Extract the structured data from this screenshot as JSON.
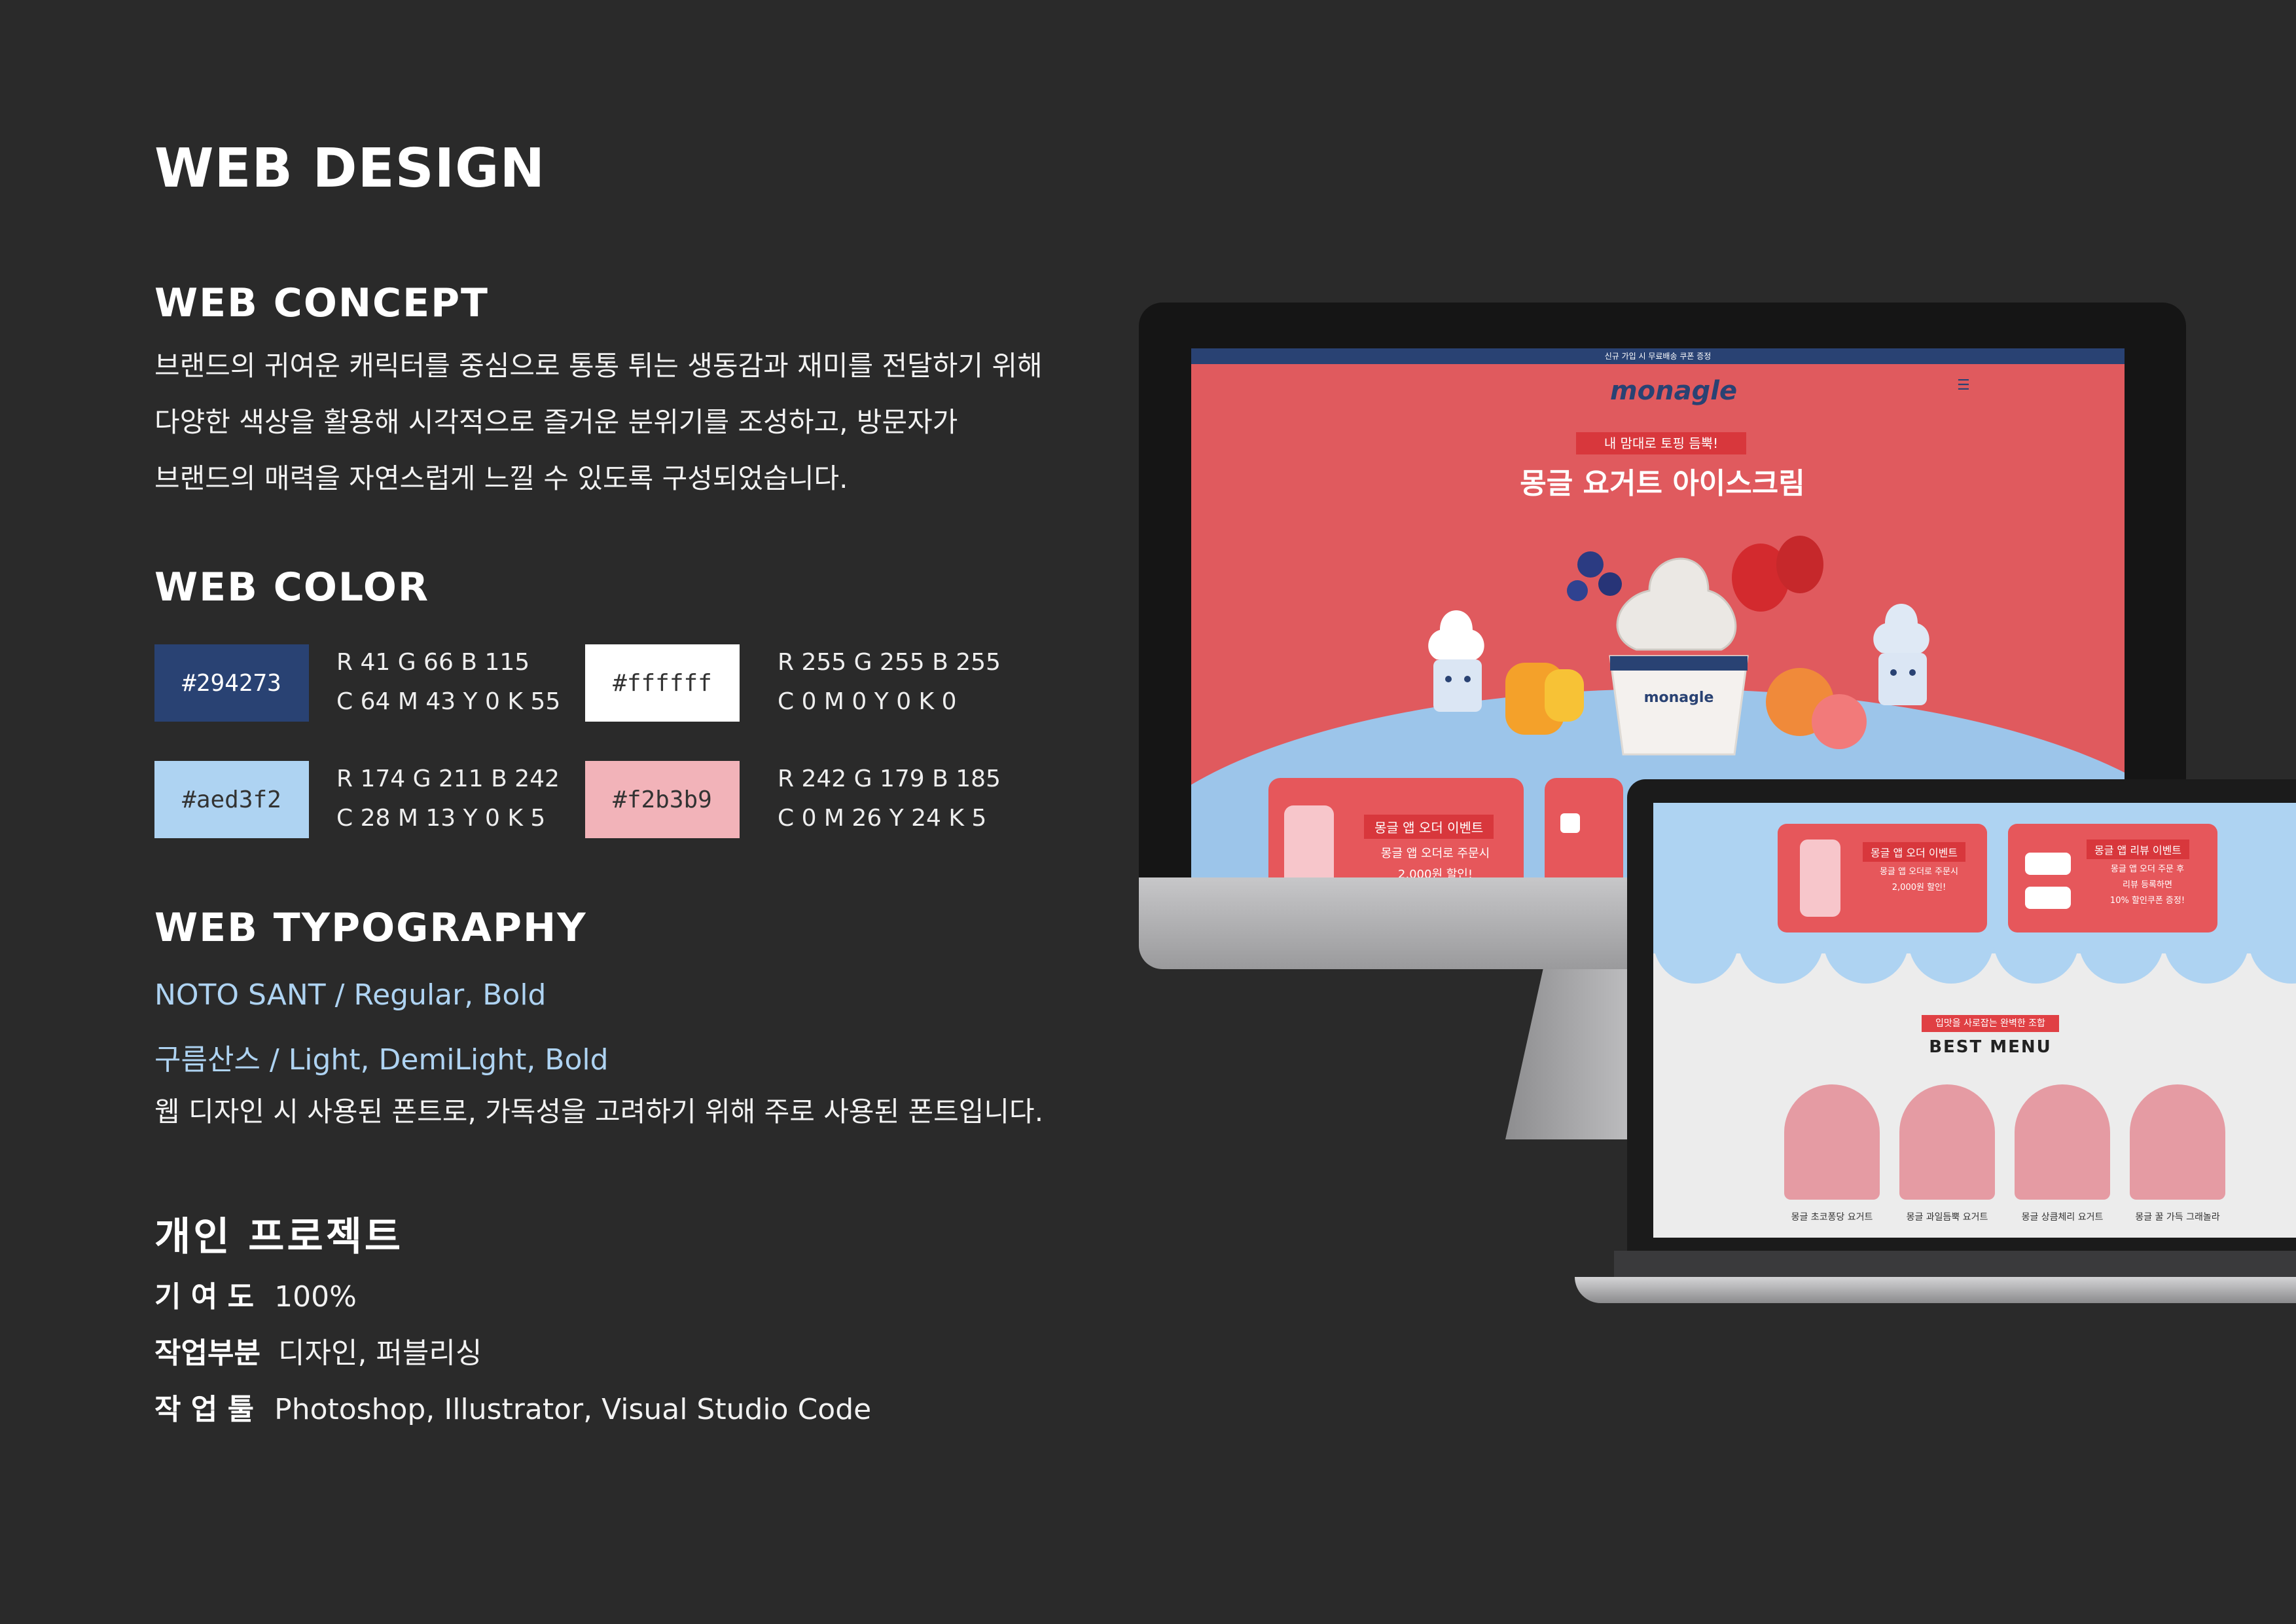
{
  "title": "WEB DESIGN",
  "concept": {
    "heading": "WEB CONCEPT",
    "lines": [
      "브랜드의 귀여운 캐릭터를 중심으로 통통 튀는 생동감과 재미를 전달하기 위해",
      "다양한 색상을 활용해 시각적으로 즐거운 분위기를 조성하고, 방문자가",
      "브랜드의 매력을 자연스럽게 느낄 수 있도록 구성되었습니다."
    ]
  },
  "color": {
    "heading": "WEB COLOR",
    "swatches": [
      {
        "hex": "#294273",
        "rgb": "R 41 G 66 B 115",
        "cmyk": "C 64 M 43 Y 0 K 55",
        "text_color": "#ffffff"
      },
      {
        "hex": "#ffffff",
        "rgb": "R 255 G 255 B 255",
        "cmyk": "C 0 M 0 Y 0 K 0",
        "text_color": "#333333"
      },
      {
        "hex": "#aed3f2",
        "rgb": "R 174 G 211 B 242",
        "cmyk": "C 28 M 13 Y 0 K 5",
        "text_color": "#333333"
      },
      {
        "hex": "#f2b3b9",
        "rgb": "R 242 G 179 B 185",
        "cmyk": "C 0 M 26 Y 24 K 5",
        "text_color": "#333333"
      }
    ]
  },
  "typography": {
    "heading": "WEB TYPOGRAPHY",
    "font1": "NOTO SANT / Regular, Bold",
    "font2": "구름산스  /  Light, DemiLight, Bold",
    "note": "웹 디자인 시 사용된 폰트로, 가독성을 고려하기 위해 주로 사용된 폰트입니다."
  },
  "project": {
    "heading": "개인 프로젝트",
    "rows": [
      {
        "label": "기 여 도",
        "value": "100%"
      },
      {
        "label": "작업부분",
        "value": "디자인, 퍼블리싱"
      },
      {
        "label": "작 업 툴",
        "value": "Photoshop, Illustrator, Visual Studio Code"
      }
    ]
  },
  "mockup_desktop": {
    "topbar": "신규 가입 시 무료배송 쿠폰 증정",
    "logo": "monagle",
    "tagline": "내 맘대로 토핑 듬뿍!",
    "hero_title": "몽글 요거트 아이스크림",
    "card1_label": "몽글 앱 오더 이벤트",
    "card1_text": "몽글 앱 오더로 주문시\n2,000원 할인!"
  },
  "mockup_laptop": {
    "card1_label": "몽글 앱 오더 이벤트",
    "card1_text": "몽글 앱 오더로 주문시\n2,000원 할인!",
    "card2_label": "몽글 앱 리뷰 이벤트",
    "card2_text": "몽글 앱 오더 주문 후\n리뷰 등록하면\n10% 할인쿠폰 증정!",
    "menu_tag": "입맛을 사로잡는 완벽한 조합",
    "menu_title": "BEST MENU",
    "menu_items": [
      "몽글 초코퐁당 요거트",
      "몽글 과일듬뿍 요거트",
      "몽글 상큼체리 요거트",
      "몽글 꿀 가득 그래놀라"
    ]
  },
  "colors": {
    "navy": "#294273",
    "white": "#ffffff",
    "sky": "#aed3f2",
    "pink": "#f2b3b9",
    "accent_text": "#aed3f2",
    "background": "#2a2a2a"
  }
}
